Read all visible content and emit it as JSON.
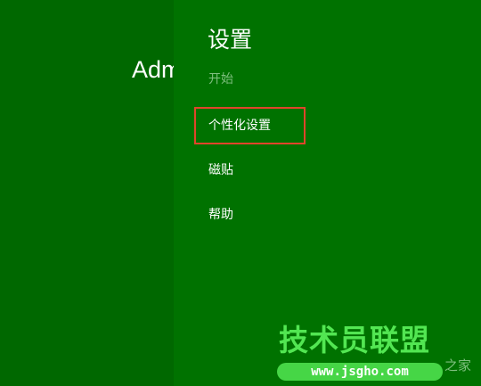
{
  "start_screen": {
    "user_name": "Administrator"
  },
  "settings_pane": {
    "title": "设置",
    "subtitle": "开始",
    "items": [
      {
        "label": "个性化设置"
      },
      {
        "label": "磁贴"
      },
      {
        "label": "帮助"
      }
    ]
  },
  "annotation": {
    "highlight_color": "#E0452B"
  },
  "watermark": {
    "title": "技术员联盟",
    "url": "www.jsgho.com",
    "suffix": "之家"
  },
  "colors": {
    "start_background": "#006800",
    "pane_background": "#007200",
    "watermark_green": "#52E652"
  }
}
